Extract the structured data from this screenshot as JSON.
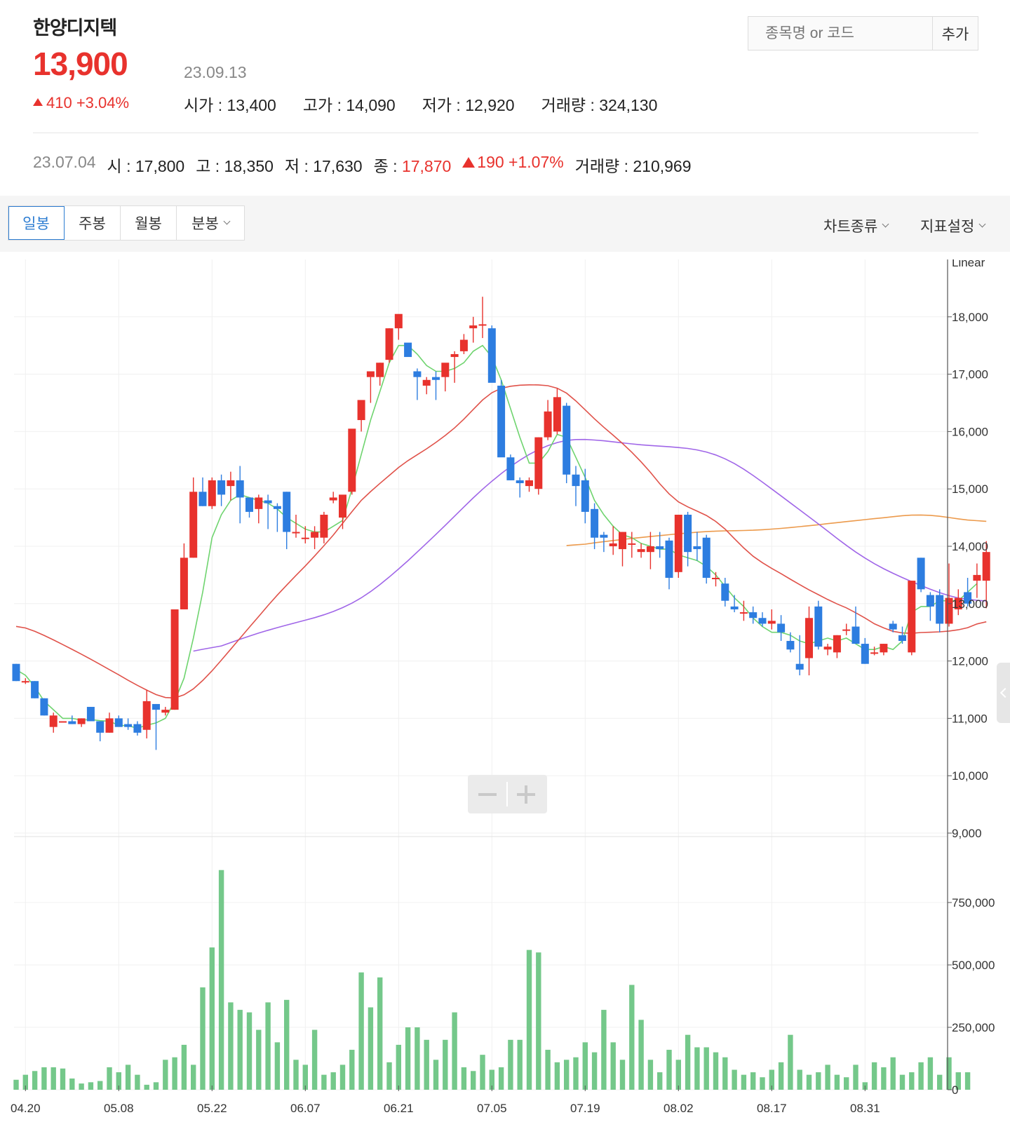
{
  "stock": {
    "name": "한양디지텍",
    "price": "13,900",
    "change": "410 +3.04%",
    "date": "23.09.13",
    "stats": [
      {
        "label": "시가",
        "value": "13,400"
      },
      {
        "label": "고가",
        "value": "14,090"
      },
      {
        "label": "저가",
        "value": "12,920"
      },
      {
        "label": "거래량",
        "value": "324,130"
      }
    ]
  },
  "search": {
    "placeholder": "종목명 or 코드",
    "add_label": "추가"
  },
  "hover": {
    "date": "23.07.04",
    "open": "시 : 17,800",
    "high": "고 : 18,350",
    "low": "저 : 17,630",
    "close_label": "종 : ",
    "close_value": "17,870",
    "change": "190 +1.07%",
    "volume": "거래량 : 210,969"
  },
  "toolbar": {
    "tabs": [
      "일봉",
      "주봉",
      "월봉",
      "분봉"
    ],
    "active_tab": 0,
    "chart_type_label": "차트종류",
    "indicator_label": "지표설정"
  },
  "colors": {
    "up": "#e8322d",
    "down": "#2d7de0",
    "volume": "#74c88a",
    "ma5": "#6fd46f",
    "ma20": "#e0524a",
    "ma60": "#a066e8",
    "ma120": "#ec9a4c",
    "accent": "#2d7dd2"
  },
  "chart_data": {
    "type": "candlestick",
    "scale_label": "Linear",
    "price_axis": {
      "ticks": [
        "18,000",
        "17,000",
        "16,000",
        "15,000",
        "14,000",
        "13,000",
        "12,000",
        "11,000",
        "10,000",
        "9,000"
      ],
      "ylim": [
        9000,
        19000
      ]
    },
    "volume_axis": {
      "ticks": [
        "750,000",
        "500,000",
        "250,000",
        "0"
      ],
      "ylim": [
        0,
        1000000
      ]
    },
    "x_ticks": [
      {
        "label": "04.20",
        "index": 1
      },
      {
        "label": "05.08",
        "index": 11
      },
      {
        "label": "05.22",
        "index": 21
      },
      {
        "label": "06.07",
        "index": 31
      },
      {
        "label": "06.21",
        "index": 41
      },
      {
        "label": "07.05",
        "index": 51
      },
      {
        "label": "07.19",
        "index": 61
      },
      {
        "label": "08.02",
        "index": 71
      },
      {
        "label": "08.17",
        "index": 81
      },
      {
        "label": "08.31",
        "index": 91
      }
    ],
    "candles": [
      [
        11950,
        11950,
        11650,
        11650
      ],
      [
        11650,
        11700,
        11600,
        11650
      ],
      [
        11650,
        11650,
        11350,
        11350
      ],
      [
        11350,
        11350,
        11050,
        11050
      ],
      [
        10850,
        11100,
        10750,
        11050
      ],
      [
        10950,
        10950,
        10950,
        10950
      ],
      [
        10950,
        11050,
        10900,
        10900
      ],
      [
        10900,
        11000,
        10850,
        11000
      ],
      [
        11200,
        11200,
        10950,
        10950
      ],
      [
        10950,
        10950,
        10600,
        10750
      ],
      [
        10750,
        11100,
        10750,
        11000
      ],
      [
        11000,
        11050,
        10900,
        10850
      ],
      [
        10900,
        11000,
        10800,
        10850
      ],
      [
        10900,
        10950,
        10700,
        10750
      ],
      [
        10800,
        11500,
        10650,
        11300
      ],
      [
        11250,
        11250,
        10450,
        11150
      ],
      [
        11100,
        11200,
        11050,
        11150
      ],
      [
        11150,
        12900,
        11150,
        12900
      ],
      [
        12900,
        14050,
        12900,
        13800
      ],
      [
        13800,
        15200,
        13800,
        14950
      ],
      [
        14950,
        15200,
        14700,
        14700
      ],
      [
        14700,
        15200,
        14650,
        15150
      ],
      [
        15150,
        15250,
        14700,
        14900
      ],
      [
        15050,
        15300,
        14800,
        15150
      ],
      [
        15150,
        15400,
        14400,
        14850
      ],
      [
        14850,
        14850,
        14500,
        14600
      ],
      [
        14650,
        14900,
        14400,
        14850
      ],
      [
        14800,
        14900,
        14300,
        14750
      ],
      [
        14700,
        14750,
        14250,
        14650
      ],
      [
        14950,
        14950,
        13950,
        14250
      ],
      [
        14250,
        14550,
        14150,
        14250
      ],
      [
        14150,
        14350,
        14050,
        14150
      ],
      [
        14150,
        14350,
        13950,
        14250
      ],
      [
        14150,
        14600,
        14050,
        14550
      ],
      [
        14800,
        14950,
        14750,
        14850
      ],
      [
        14500,
        14550,
        14300,
        14900
      ],
      [
        14950,
        16000,
        14900,
        16050
      ],
      [
        16200,
        16500,
        16000,
        16550
      ],
      [
        16950,
        16950,
        16500,
        17050
      ],
      [
        16950,
        17200,
        16800,
        17200
      ],
      [
        17250,
        17800,
        17200,
        17800
      ],
      [
        17800,
        18000,
        17600,
        18050
      ],
      [
        17550,
        17250,
        17250,
        17300
      ],
      [
        17050,
        17100,
        16550,
        16950
      ],
      [
        16800,
        16950,
        16650,
        16900
      ],
      [
        16950,
        17050,
        16550,
        16900
      ],
      [
        16950,
        17150,
        16700,
        17200
      ],
      [
        17300,
        17400,
        16850,
        17350
      ],
      [
        17400,
        17700,
        17350,
        17600
      ],
      [
        17800,
        18000,
        17550,
        17850
      ],
      [
        17850,
        18350,
        17630,
        17870
      ],
      [
        17800,
        17850,
        16900,
        16850
      ],
      [
        16800,
        16900,
        15650,
        15550
      ],
      [
        15550,
        15600,
        15150,
        15150
      ],
      [
        15150,
        15200,
        14850,
        15100
      ],
      [
        15050,
        15200,
        14950,
        15150
      ],
      [
        15000,
        15900,
        14900,
        15900
      ],
      [
        15900,
        16550,
        15850,
        16350
      ],
      [
        16000,
        16750,
        15950,
        16600
      ],
      [
        16450,
        16500,
        15100,
        15250
      ],
      [
        15250,
        15400,
        14700,
        15050
      ],
      [
        15150,
        15350,
        14400,
        14600
      ],
      [
        14650,
        14750,
        13950,
        14150
      ],
      [
        14200,
        14250,
        13900,
        14150
      ],
      [
        14000,
        14350,
        13850,
        14050
      ],
      [
        13950,
        14250,
        13650,
        14250
      ],
      [
        14050,
        14250,
        13800,
        14050
      ],
      [
        13900,
        14050,
        13800,
        13950
      ],
      [
        13900,
        14250,
        13600,
        14000
      ],
      [
        14000,
        14250,
        13800,
        13950
      ],
      [
        14100,
        14150,
        13250,
        13450
      ],
      [
        13550,
        14550,
        13450,
        14550
      ],
      [
        14550,
        14600,
        13650,
        13900
      ],
      [
        14000,
        14250,
        13750,
        13950
      ],
      [
        14150,
        14200,
        13350,
        13450
      ],
      [
        13450,
        13550,
        13300,
        13450
      ],
      [
        13350,
        13450,
        12950,
        13050
      ],
      [
        12950,
        13150,
        12850,
        12900
      ],
      [
        12850,
        13050,
        12700,
        12850
      ],
      [
        12850,
        12950,
        12650,
        12750
      ],
      [
        12750,
        12850,
        12600,
        12650
      ],
      [
        12650,
        12900,
        12550,
        12700
      ],
      [
        12650,
        12800,
        12350,
        12500
      ],
      [
        12350,
        12500,
        12150,
        12200
      ],
      [
        11950,
        12450,
        11750,
        11850
      ],
      [
        12050,
        12950,
        11750,
        12750
      ],
      [
        12950,
        13050,
        12200,
        12250
      ],
      [
        12200,
        12300,
        12100,
        12250
      ],
      [
        12150,
        12450,
        12050,
        12450
      ],
      [
        12550,
        12650,
        12450,
        12550
      ],
      [
        12600,
        12950,
        12350,
        12300
      ],
      [
        12300,
        12400,
        11950,
        11950
      ],
      [
        12150,
        12250,
        12100,
        12150
      ],
      [
        12150,
        12300,
        12100,
        12300
      ],
      [
        12650,
        12700,
        12500,
        12550
      ],
      [
        12450,
        12600,
        12300,
        12350
      ],
      [
        12150,
        13400,
        12100,
        13400
      ],
      [
        13800,
        13800,
        13200,
        13250
      ],
      [
        13150,
        13200,
        12700,
        12950
      ],
      [
        13150,
        13250,
        12500,
        12650
      ],
      [
        12650,
        13700,
        12600,
        13100
      ],
      [
        12900,
        13250,
        12800,
        13100
      ],
      [
        13200,
        13450,
        12950,
        13000
      ],
      [
        13400,
        13700,
        13100,
        13500
      ],
      [
        13400,
        14090,
        12920,
        13900
      ]
    ],
    "volumes": [
      40000,
      60000,
      75000,
      90000,
      90000,
      85000,
      45000,
      25000,
      30000,
      35000,
      90000,
      70000,
      100000,
      60000,
      20000,
      30000,
      120000,
      130000,
      180000,
      100000,
      410000,
      570000,
      880000,
      350000,
      320000,
      310000,
      240000,
      350000,
      190000,
      360000,
      120000,
      100000,
      240000,
      60000,
      70000,
      100000,
      160000,
      470000,
      330000,
      450000,
      110000,
      180000,
      250000,
      250000,
      200000,
      120000,
      200000,
      310000,
      90000,
      75000,
      140000,
      80000,
      90000,
      200000,
      200000,
      560000,
      550000,
      160000,
      110000,
      120000,
      130000,
      190000,
      150000,
      320000,
      190000,
      120000,
      420000,
      280000,
      120000,
      70000,
      160000,
      120000,
      220000,
      170000,
      170000,
      150000,
      130000,
      80000,
      60000,
      70000,
      50000,
      80000,
      110000,
      220000,
      80000,
      60000,
      70000,
      100000,
      60000,
      50000,
      100000,
      30000,
      110000,
      90000,
      130000,
      60000,
      70000,
      110000,
      130000,
      60000,
      130000,
      70000,
      70000
    ],
    "ma5": [
      11850,
      11750,
      11550,
      11300,
      11150,
      11000,
      11000,
      10970,
      10980,
      10960,
      10950,
      10880,
      10870,
      10830,
      10880,
      10920,
      11000,
      11300,
      11700,
      12400,
      13200,
      14150,
      14550,
      14800,
      14900,
      14850,
      14800,
      14750,
      14650,
      14500,
      14400,
      14300,
      14250,
      14250,
      14350,
      14450,
      15000,
      15600,
      16200,
      16700,
      17200,
      17500,
      17500,
      17350,
      17150,
      17050,
      17050,
      17100,
      17200,
      17400,
      17500,
      17300,
      16900,
      16400,
      15900,
      15450,
      15450,
      15650,
      15950,
      15900,
      15550,
      15200,
      14800,
      14550,
      14350,
      14200,
      14150,
      14050,
      14000,
      13950,
      13950,
      13850,
      13800,
      13750,
      13650,
      13500,
      13300,
      13100,
      12950,
      12750,
      12600,
      12500,
      12500,
      12450,
      12350,
      12300,
      12350,
      12400,
      12350,
      12400,
      12300,
      12200,
      12200,
      12250,
      12200,
      12350,
      12850,
      12950,
      12950,
      13050,
      13050,
      13050,
      13200,
      13350
    ]
  }
}
